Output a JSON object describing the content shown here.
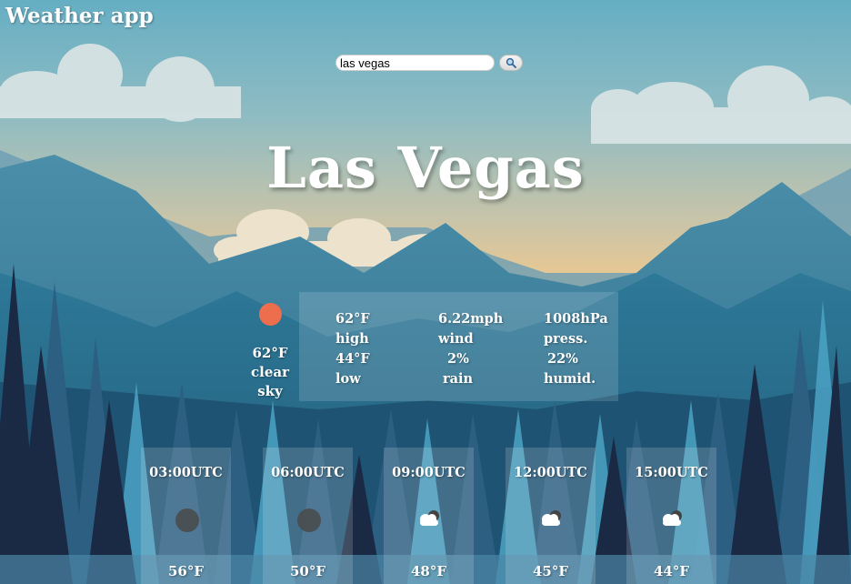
{
  "app": {
    "title": "Weather app"
  },
  "search": {
    "value": "las vegas",
    "button_icon": "search-icon"
  },
  "city": {
    "name": "Las Vegas"
  },
  "current": {
    "icon": "sun-icon",
    "temp": "62°F",
    "desc_line1": "clear",
    "desc_line2": "sky"
  },
  "stats": {
    "high_value": "62°F",
    "high_label": "high",
    "low_value": "44°F",
    "low_label": "low",
    "wind_value": "6.22mph",
    "wind_label": "wind",
    "rain_value": "2%",
    "rain_label": "rain",
    "pressure_value": "1008hPa",
    "pressure_label": "press.",
    "humidity_value": "22%",
    "humidity_label": "humid."
  },
  "forecast": [
    {
      "time": "03:00UTC",
      "icon": "moon-icon",
      "temp": "56°F"
    },
    {
      "time": "06:00UTC",
      "icon": "moon-icon",
      "temp": "50°F"
    },
    {
      "time": "09:00UTC",
      "icon": "cloud-icon",
      "temp": "48°F"
    },
    {
      "time": "12:00UTC",
      "icon": "cloud-icon",
      "temp": "45°F"
    },
    {
      "time": "15:00UTC",
      "icon": "cloud-icon",
      "temp": "44°F"
    }
  ],
  "colors": {
    "sky_top": "#6aaec0",
    "sky_bottom": "#f2c98c",
    "sun": "#ec6e4c",
    "mountain": "#3f86a6",
    "forest_dark": "#1b2a44"
  }
}
